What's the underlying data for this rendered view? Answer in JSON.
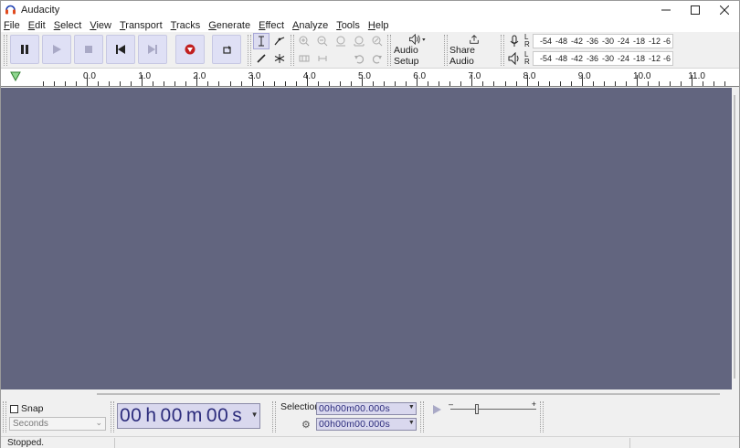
{
  "window": {
    "title": "Audacity"
  },
  "menu": [
    "File",
    "Edit",
    "Select",
    "View",
    "Transport",
    "Tracks",
    "Generate",
    "Effect",
    "Analyze",
    "Tools",
    "Help"
  ],
  "toolbar": {
    "audio_setup_label": "Audio Setup",
    "share_audio_label": "Share Audio",
    "meter_labels": [
      "-54",
      "-48",
      "-42",
      "-36",
      "-30",
      "-24",
      "-18",
      "-12",
      "-6"
    ],
    "meter_lr": [
      "L",
      "R"
    ]
  },
  "ruler": {
    "labels": [
      "0.0",
      "1.0",
      "2.0",
      "3.0",
      "4.0",
      "5.0",
      "6.0",
      "7.0",
      "8.0",
      "9.0",
      "10.0",
      "11.0"
    ]
  },
  "bottom": {
    "snap_label": "Snap",
    "snap_checked": false,
    "snap_unit": "Seconds",
    "time": {
      "h": "00",
      "m": "00",
      "s": "00",
      "h_unit": "h",
      "m_unit": "m",
      "s_unit": "s"
    },
    "selection_label": "Selection",
    "selection_start": "00h00m00.000s",
    "selection_end": "00h00m00.000s"
  },
  "status": {
    "text": "Stopped."
  },
  "colors": {
    "track_bg": "#62657f",
    "button_bg": "#dfe0f5",
    "record": "#c12020"
  }
}
